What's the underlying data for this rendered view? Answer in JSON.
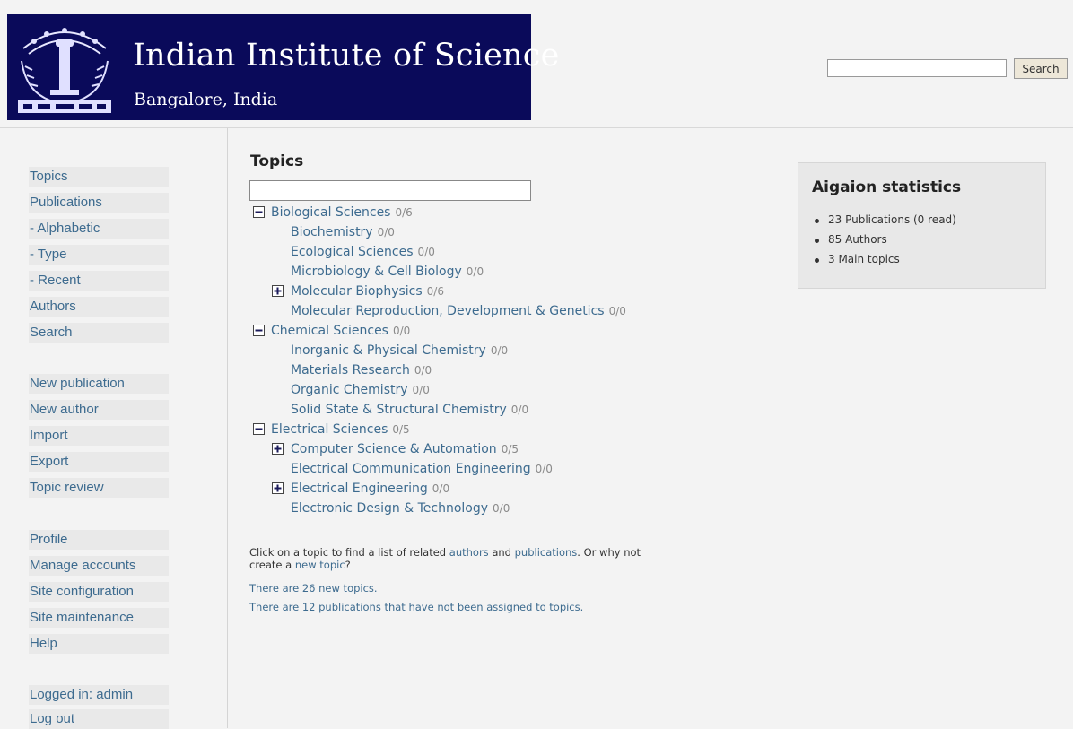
{
  "header": {
    "institute_name": "Indian Institute of Science",
    "location": "Bangalore, India",
    "search_button": "Search",
    "search_value": ""
  },
  "sidebar": {
    "items": [
      "Topics",
      "Publications",
      "- Alphabetic",
      "- Type",
      "- Recent",
      "Authors",
      "Search",
      "New publication",
      "New author",
      "Import",
      "Export",
      "Topic review",
      "Profile",
      "Manage accounts",
      "Site configuration",
      "Site maintenance",
      "Help",
      "Logged in: admin",
      "Log out"
    ]
  },
  "main": {
    "heading": "Topics",
    "filter_value": "",
    "topics": [
      {
        "name": "Biological Sciences",
        "count": "0/6",
        "expander": "collapse"
      },
      {
        "name": "Biochemistry",
        "count": "0/0",
        "expander": "none"
      },
      {
        "name": "Ecological Sciences",
        "count": "0/0",
        "expander": "none"
      },
      {
        "name": "Microbiology & Cell Biology",
        "count": "0/0",
        "expander": "none"
      },
      {
        "name": "Molecular Biophysics",
        "count": "0/6",
        "expander": "expand"
      },
      {
        "name": "Molecular Reproduction, Development & Genetics",
        "count": "0/0",
        "expander": "none"
      },
      {
        "name": "Chemical Sciences",
        "count": "0/0",
        "expander": "collapse"
      },
      {
        "name": "Inorganic & Physical Chemistry",
        "count": "0/0",
        "expander": "none"
      },
      {
        "name": "Materials Research",
        "count": "0/0",
        "expander": "none"
      },
      {
        "name": "Organic Chemistry",
        "count": "0/0",
        "expander": "none"
      },
      {
        "name": "Solid State & Structural Chemistry",
        "count": "0/0",
        "expander": "none"
      },
      {
        "name": "Electrical Sciences",
        "count": "0/5",
        "expander": "collapse"
      },
      {
        "name": "Computer Science & Automation",
        "count": "0/5",
        "expander": "expand"
      },
      {
        "name": "Electrical Communication Engineering",
        "count": "0/0",
        "expander": "none"
      },
      {
        "name": "Electrical Engineering",
        "count": "0/0",
        "expander": "expand"
      },
      {
        "name": "Electronic Design & Technology",
        "count": "0/0",
        "expander": "none"
      }
    ],
    "footer": {
      "line1_a": "Click on a topic to find a list of related",
      "authors_link": "authors",
      "and": "and",
      "publications_link": "publications",
      "line1_b": ". Or why not",
      "line2_a": "create a",
      "new_topic_link": "new topic",
      "line2_b": "?",
      "new_topics": "There are 26 new topics.",
      "unassigned": "There are 12 publications that have not been assigned to topics."
    }
  },
  "stats": {
    "title": "Aigaion statistics",
    "items": [
      "23 Publications (0 read)",
      "85 Authors",
      "3 Main topics"
    ]
  },
  "colors": {
    "header_bg": "#0a0a5a",
    "link": "#3d6b8f",
    "page_bg": "#f3f3f3"
  }
}
